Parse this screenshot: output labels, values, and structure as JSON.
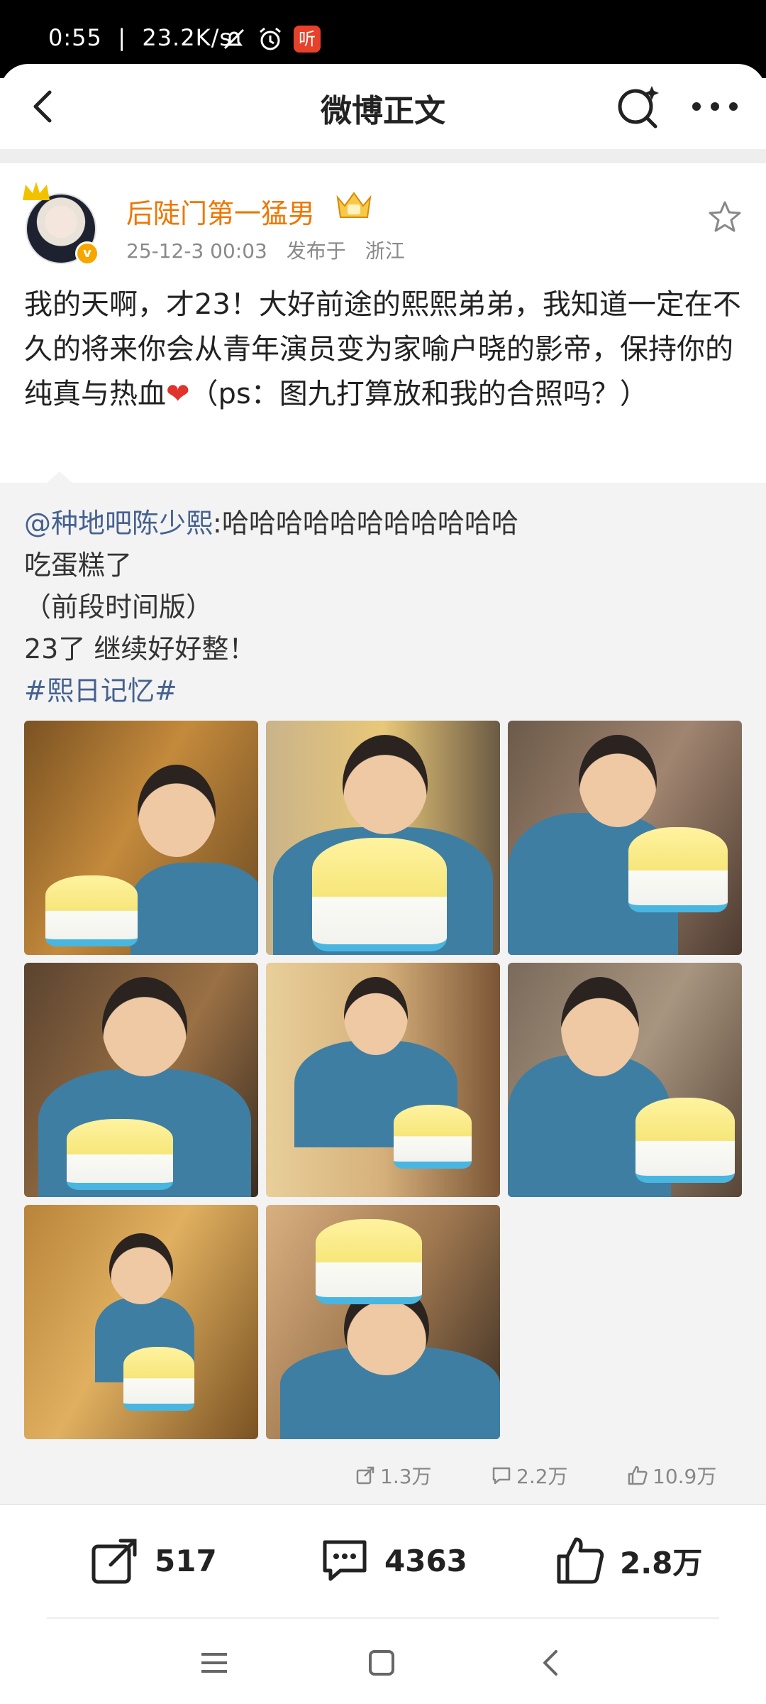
{
  "status_bar": {
    "time": "0:55",
    "speed": "23.2K/s",
    "ting_label": "听"
  },
  "header": {
    "title": "微博正文"
  },
  "post": {
    "username": "后陡门第一猛男",
    "date": "25-12-3 00:03",
    "posted_from_label": "发布于",
    "location": "浙江",
    "verified_mark": "v",
    "text_before_heart": "我的天啊，才23！大好前途的熙熙弟弟，我知道一定在不久的将来你会从青年演员变为家喻户晓的影帝，保持你的纯真与热血",
    "text_after_heart": "（ps：图九打算放和我的合照吗？）"
  },
  "repost": {
    "mention": "@种地吧陈少熙",
    "line1_rest": ":哈哈哈哈哈哈哈哈哈哈哈",
    "line2": "吃蛋糕了",
    "line3": "（前段时间版）",
    "line4": "23了 继续好好整！",
    "topic": "#熙日记忆#",
    "photo_count": 8,
    "stats": {
      "reposts": "1.3万",
      "comments": "2.2万",
      "likes": "10.9万"
    }
  },
  "actions": {
    "repost_count": "517",
    "comment_count": "4363",
    "like_count": "2.8万"
  },
  "colors": {
    "username": "#ee7700",
    "link": "#45618e",
    "heart": "#e0342b"
  }
}
